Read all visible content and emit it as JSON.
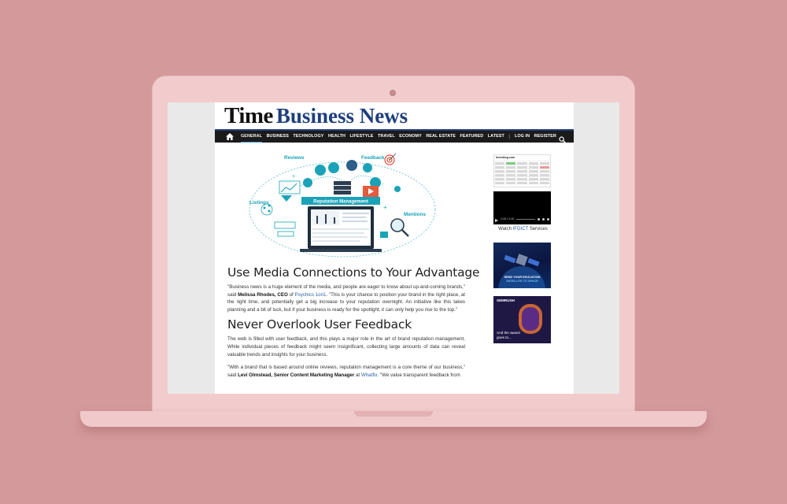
{
  "site": {
    "logo_part1": "Time",
    "logo_part2": "Business News"
  },
  "nav": {
    "items": [
      "GENERAL",
      "BUSINESS",
      "TECHNOLOGY",
      "HEALTH",
      "LIFESTYLE",
      "TRAVEL",
      "ECONOMY",
      "REAL ESTATE",
      "FEATURED",
      "LATEST"
    ],
    "separator": "|",
    "login": "LOG IN",
    "register": "REGISTER"
  },
  "illustration": {
    "labels": {
      "reviews": "Reviews",
      "feedback": "Feedback",
      "listings": "Listings",
      "mentions": "Mentions",
      "banner": "Reputation Management"
    }
  },
  "article": {
    "heading1": "Use Media Connections to Your Advantage",
    "p1_a": "\"Business news is a huge element of the media, and people are eager to know about up-and-coming brands,\" said ",
    "p1_name": "Melissa Rhodes, CEO",
    "p1_of": " of ",
    "p1_link": "Psychics 1on1",
    "p1_b": ". \"This is your chance to position your brand in the right place, at the right time, and potentially get a big increase to your reputation overnight. An initiative like this takes planning and a bit of luck, but if your business is ready for the spotlight, it can only help you rise to the top.\"",
    "heading2": "Never Overlook User Feedback",
    "p2": "The web is filled with user feedback, and this plays a major role in the art of brand reputation management. While individual pieces of feedback might seem insignificant, collecting large amounts of data can reveal valuable trends and insights for your business.",
    "p3_a": "\"With a brand that is based around online reviews, reputation management is a core theme of our business,\" said ",
    "p3_name": "Levi Olmstead, Senior Content Marketing Manager",
    "p3_at": " at ",
    "p3_link": "Whatfix",
    "p3_b": ". \"We value transparent feedback from"
  },
  "sidebar": {
    "table_title": "Investing.com",
    "video_time": "1:10 / 1:10",
    "video_caption_prefix": "Watch ",
    "video_caption_link": "IFGICT",
    "video_caption_suffix": " Services",
    "ad1_line1": "SEND YOUR EDUCATION",
    "ad1_line2": "SATELLITE TO SPACE",
    "ad2_logo": "SEMRUSH",
    "ad2_line1": "And the award",
    "ad2_line2": "goes to..."
  },
  "colors": {
    "background": "#d4999b",
    "laptop": "#f2cccd",
    "nav_bg": "#1b1b1b",
    "brand_blue": "#1f3f7d",
    "link": "#2a5ea8",
    "illustration_teal": "#1aa3b8"
  }
}
